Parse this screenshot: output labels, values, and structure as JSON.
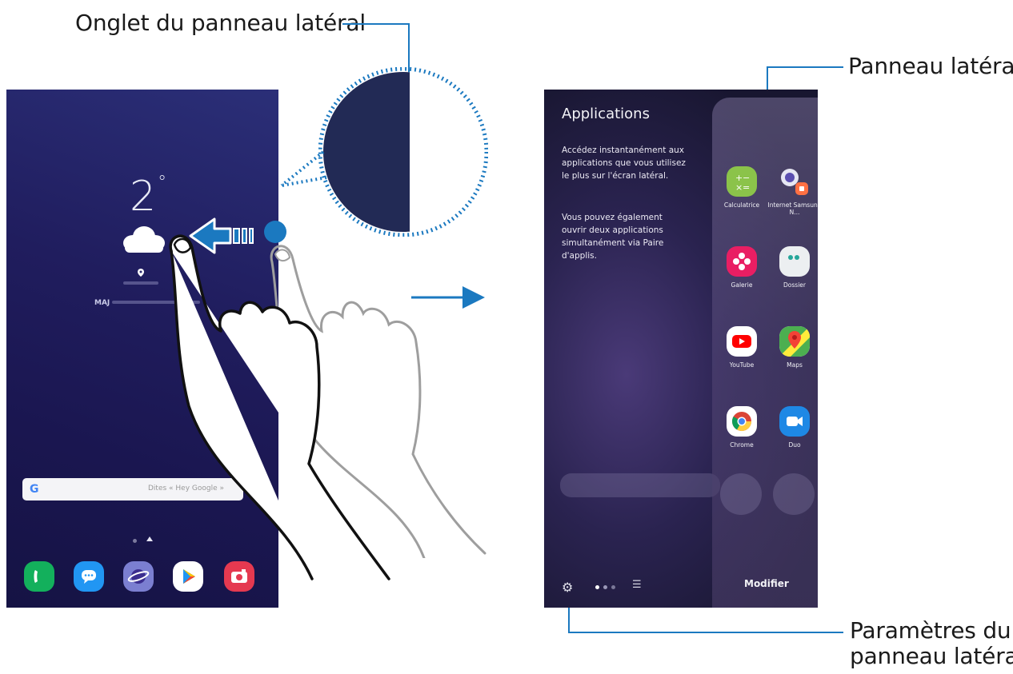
{
  "callouts": {
    "edge_tab": "Onglet du panneau latéral",
    "edge_panel": "Panneau latéral",
    "settings_line1": "Paramètres du",
    "settings_line2": "panneau latéral"
  },
  "left_phone": {
    "temperature": "2",
    "degree": "°",
    "update_prefix": "MAJ",
    "search_logo": "G",
    "search_placeholder": "Dites « Hey Google »"
  },
  "right_phone": {
    "title": "Applications",
    "description_1": "Accédez instantanément aux applications que vous utilisez le plus sur l'écran latéral.",
    "description_2": "Vous pouvez également ouvrir deux applications simultanément via Paire d'applis.",
    "apps": [
      {
        "label": "Calculatrice",
        "icon": "calculator-icon",
        "color": "#8bc34a"
      },
      {
        "label": "Internet Samsung N...",
        "icon": "internet-icon",
        "color": "#e6e7f3"
      },
      {
        "label": "Galerie",
        "icon": "gallery-icon",
        "color": "#e91e63"
      },
      {
        "label": "Dossier",
        "icon": "folder-icon",
        "color": "#eceff1"
      },
      {
        "label": "YouTube",
        "icon": "youtube-icon",
        "color": "#ffffff"
      },
      {
        "label": "Maps",
        "icon": "maps-icon",
        "color": "#ffffff"
      },
      {
        "label": "Chrome",
        "icon": "chrome-icon",
        "color": "#ffffff"
      },
      {
        "label": "Duo",
        "icon": "duo-icon",
        "color": "#1e88e5"
      }
    ],
    "settings_icon": "gear-icon",
    "edit_label": "Modifier"
  },
  "colors": {
    "accent": "#1b79c0",
    "wallpaper": "#201d5e"
  }
}
